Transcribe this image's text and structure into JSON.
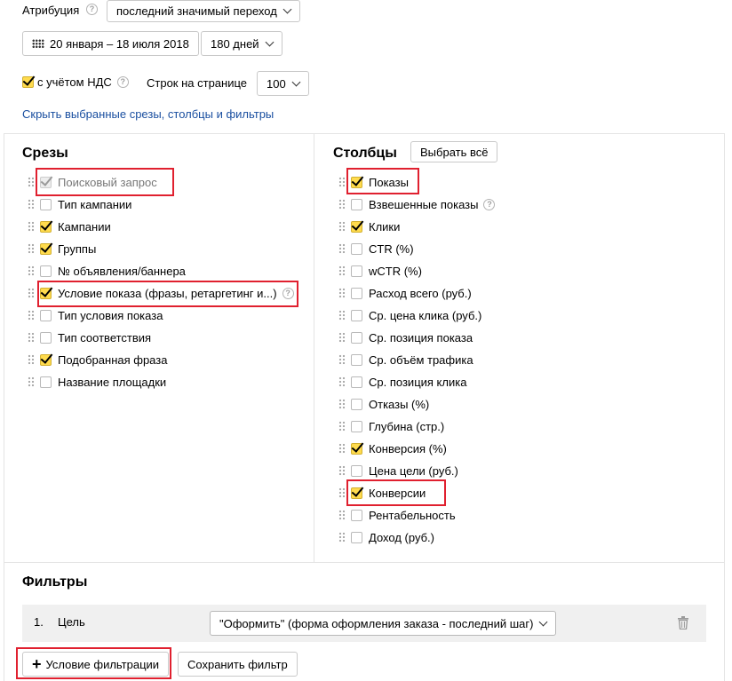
{
  "settings": {
    "attribution_label": "Атрибуция",
    "attribution_value": "последний значимый переход",
    "date_range": "20 января – 18 июля 2018",
    "period": "180 дней",
    "vat_label": "с учётом НДС",
    "rows_label": "Строк на странице",
    "rows_value": "100",
    "hide_link": "Скрыть выбранные срезы, столбцы и фильтры"
  },
  "slices": {
    "title": "Срезы",
    "items": [
      {
        "label": "Поисковый запрос",
        "checked": true,
        "disabled": true,
        "help": false
      },
      {
        "label": "Тип кампании",
        "checked": false,
        "help": false
      },
      {
        "label": "Кампании",
        "checked": true,
        "help": false
      },
      {
        "label": "Группы",
        "checked": true,
        "help": false
      },
      {
        "label": "№ объявления/баннера",
        "checked": false,
        "help": false
      },
      {
        "label": "Условие показа (фразы, ретаргетинг и...)",
        "checked": true,
        "help": true
      },
      {
        "label": "Тип условия показа",
        "checked": false,
        "help": false
      },
      {
        "label": "Тип соответствия",
        "checked": false,
        "help": false
      },
      {
        "label": "Подобранная фраза",
        "checked": true,
        "help": false
      },
      {
        "label": "Название площадки",
        "checked": false,
        "help": false
      }
    ]
  },
  "columns": {
    "title": "Столбцы",
    "select_all": "Выбрать всё",
    "items": [
      {
        "label": "Показы",
        "checked": true,
        "help": false
      },
      {
        "label": "Взвешенные показы",
        "checked": false,
        "help": true
      },
      {
        "label": "Клики",
        "checked": true,
        "help": false
      },
      {
        "label": "CTR (%)",
        "checked": false,
        "help": false
      },
      {
        "label": "wCTR (%)",
        "checked": false,
        "help": false
      },
      {
        "label": "Расход всего (руб.)",
        "checked": false,
        "help": false
      },
      {
        "label": "Ср. цена клика (руб.)",
        "checked": false,
        "help": false
      },
      {
        "label": "Ср. позиция показа",
        "checked": false,
        "help": false
      },
      {
        "label": "Ср. объём трафика",
        "checked": false,
        "help": false
      },
      {
        "label": "Ср. позиция клика",
        "checked": false,
        "help": false
      },
      {
        "label": "Отказы (%)",
        "checked": false,
        "help": false
      },
      {
        "label": "Глубина (стр.)",
        "checked": false,
        "help": false
      },
      {
        "label": "Конверсия (%)",
        "checked": true,
        "help": false
      },
      {
        "label": "Цена цели (руб.)",
        "checked": false,
        "help": false
      },
      {
        "label": "Конверсии",
        "checked": true,
        "help": false
      },
      {
        "label": "Рентабельность",
        "checked": false,
        "help": false
      },
      {
        "label": "Доход (руб.)",
        "checked": false,
        "help": false
      }
    ]
  },
  "filters": {
    "title": "Фильтры",
    "rows": [
      {
        "index": "1.",
        "field": "Цель",
        "value": "\"Оформить\" (форма оформления заказа - последний шаг)"
      }
    ],
    "add_condition": "Условие фильтрации",
    "save_filter": "Сохранить фильтр"
  },
  "colors": {
    "checkbox_on": "#ffdb4d",
    "link": "#1a4fa0",
    "highlight": "#e0202f"
  }
}
